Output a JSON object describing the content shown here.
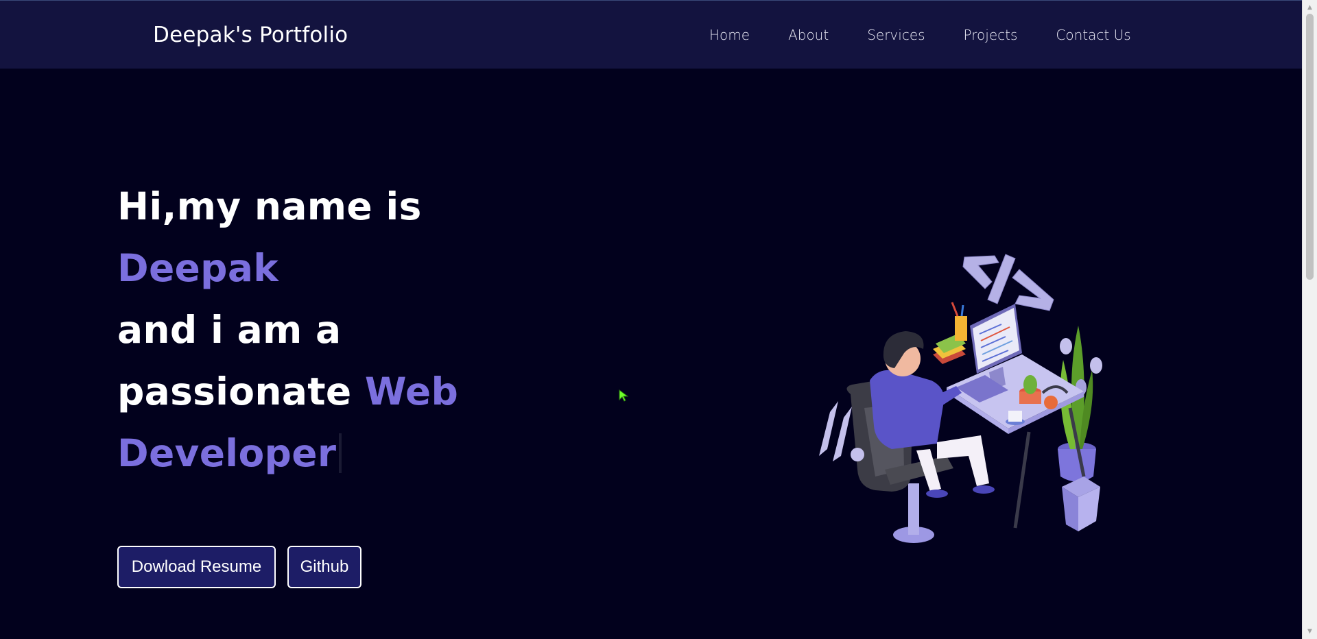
{
  "nav": {
    "brand": "Deepak's Portfolio",
    "links": [
      "Home",
      "About",
      "Services",
      "Projects",
      "Contact Us"
    ]
  },
  "hero": {
    "line1": "Hi,my name is",
    "name": "Deepak",
    "line3": "and i am a",
    "line4_prefix": "passionate ",
    "role_part1": "Web",
    "role_part2": "Developer"
  },
  "buttons": {
    "resume": "Dowload Resume",
    "github": "Github"
  },
  "illustration": {
    "code_symbol": "</>"
  },
  "colors": {
    "background": "#02011d",
    "navbar": "#13133f",
    "accent": "#7b6fde",
    "button_bg": "#1d1d66"
  },
  "icons": [
    "code-icon",
    "developer-illustration",
    "mouse-cursor-icon",
    "scroll-up-arrow-icon",
    "scroll-down-arrow-icon"
  ]
}
